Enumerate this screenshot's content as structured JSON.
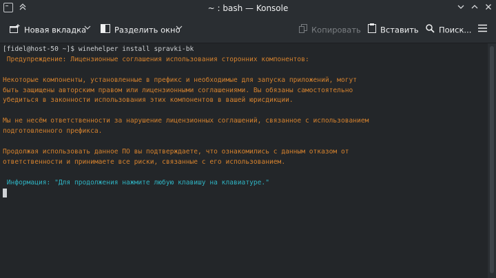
{
  "window": {
    "title": "~ : bash — Konsole"
  },
  "toolbar": {
    "new_tab_label": "Новая вкладка",
    "split_view_label": "Разделить окно",
    "copy_label": "Копировать",
    "paste_label": "Вставить",
    "find_label": "Поиск..."
  },
  "terminal": {
    "lines": [
      {
        "text": "[fidel@host-50 ~]$ winehelper install spravki-bk",
        "style": "prompt"
      },
      {
        "text": " Предупреждение: Лицензионные соглашения использования сторонних компонентов:",
        "style": "warn"
      },
      {
        "text": "",
        "style": "warn"
      },
      {
        "text": "Некоторые компоненты, установленные в префикс и необходимые для запуска приложений, могут",
        "style": "warn"
      },
      {
        "text": "быть защищены авторским правом или лицензионными соглашениями. Вы обязаны самостоятельно",
        "style": "warn"
      },
      {
        "text": "убедиться в законности использования этих компонентов в вашей юрисдикции.",
        "style": "warn"
      },
      {
        "text": "",
        "style": "warn"
      },
      {
        "text": "Мы не несём ответственности за нарушение лицензионных соглашений, связанное с использованием",
        "style": "warn"
      },
      {
        "text": "подготовленного префикса.",
        "style": "warn"
      },
      {
        "text": "",
        "style": "warn"
      },
      {
        "text": "Продолжая использовать данное ПО вы подтверждаете, что ознакомились с данным отказом от",
        "style": "warn"
      },
      {
        "text": "ответственности и принимаете все риски, связанные с его использованием.",
        "style": "warn"
      },
      {
        "text": "",
        "style": "warn"
      },
      {
        "text": " Информация: \"Для продолжения нажмите любую клавишу на клавиатуре.\"",
        "style": "info"
      }
    ]
  },
  "colors": {
    "warning_text": "#d5822e",
    "info_text": "#2fb3c2",
    "background": "#232629"
  }
}
